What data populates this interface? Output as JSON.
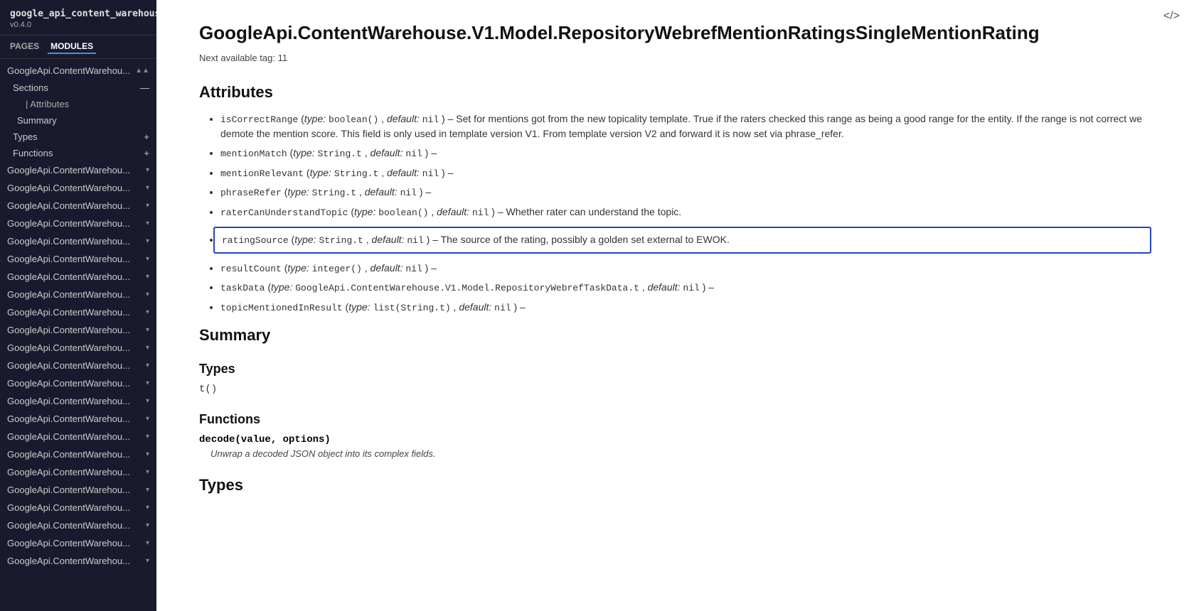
{
  "sidebar": {
    "app_title": "google_api_content_warehouse",
    "version": "v0.4.0",
    "tabs": [
      {
        "label": "PAGES",
        "active": false
      },
      {
        "label": "MODULES",
        "active": true
      }
    ],
    "nav": {
      "active_module": "GoogleApi.ContentWarehou...",
      "active_module_arrow": "▲",
      "sections_label": "Sections",
      "sections_collapse": "—",
      "attributes_indent": "| Attributes",
      "summary_label": "Summary",
      "types_label": "Types",
      "types_plus": "+",
      "functions_label": "Functions",
      "functions_plus": "+",
      "other_modules": [
        "GoogleApi.ContentWarehou...",
        "GoogleApi.ContentWarehou...",
        "GoogleApi.ContentWarehou...",
        "GoogleApi.ContentWarehou...",
        "GoogleApi.ContentWarehou...",
        "GoogleApi.ContentWarehou...",
        "GoogleApi.ContentWarehou...",
        "GoogleApi.ContentWarehou...",
        "GoogleApi.ContentWarehou...",
        "GoogleApi.ContentWarehou...",
        "GoogleApi.ContentWarehou...",
        "GoogleApi.ContentWarehou...",
        "GoogleApi.ContentWarehou...",
        "GoogleApi.ContentWarehou...",
        "GoogleApi.ContentWarehou...",
        "GoogleApi.ContentWarehou...",
        "GoogleApi.ContentWarehou...",
        "GoogleApi.ContentWarehou...",
        "GoogleApi.ContentWarehou...",
        "GoogleApi.ContentWarehou...",
        "GoogleApi.ContentWarehou...",
        "GoogleApi.ContentWarehou...",
        "GoogleApi.ContentWarehou..."
      ]
    }
  },
  "top_right_icon": "</>",
  "main": {
    "page_title": "GoogleApi.ContentWarehouse.V1.Model.RepositoryWebrefMentionRatingsSingleMentionRating",
    "next_tag_label": "Next available tag:",
    "next_tag_value": "11",
    "attributes_heading": "Attributes",
    "attributes": [
      {
        "name": "isCorrectRange",
        "type": "type: boolean()",
        "default": "default: nil",
        "desc": "– Set for mentions got from the new topicality template. True if the raters checked this range as being a good range for the entity. If the range is not correct we demote the mention score. This field is only used in template version V1. From template version V2 and forward it is now set via phrase_refer.",
        "highlighted": false
      },
      {
        "name": "mentionMatch",
        "type": "type: String.t",
        "default": "default: nil",
        "desc": "–",
        "highlighted": false
      },
      {
        "name": "mentionRelevant",
        "type": "type: String.t",
        "default": "default: nil",
        "desc": "–",
        "highlighted": false
      },
      {
        "name": "phraseRefer",
        "type": "type: String.t",
        "default": "default: nil",
        "desc": "–",
        "highlighted": false
      },
      {
        "name": "raterCanUnderstandTopic",
        "type": "type: boolean()",
        "default": "default: nil",
        "desc": "– Whether rater can understand the topic.",
        "highlighted": false
      },
      {
        "name": "ratingSource",
        "type": "type: String.t",
        "default": "default: nil",
        "desc": "– The source of the rating, possibly a golden set external to EWOK.",
        "highlighted": true
      },
      {
        "name": "resultCount",
        "type": "type: integer()",
        "default": "default: nil",
        "desc": "–",
        "highlighted": false
      },
      {
        "name": "taskData",
        "type": "type: GoogleApi.ContentWarehouse.V1.Model.RepositoryWebrefTaskData.t",
        "default": "default: nil",
        "desc": "–",
        "highlighted": false
      },
      {
        "name": "topicMentionedInResult",
        "type": "type: list(String.t)",
        "default": "default: nil",
        "desc": "–",
        "highlighted": false
      }
    ],
    "summary_heading": "Summary",
    "types_heading": "Types",
    "type_sig": "t()",
    "functions_heading": "Functions",
    "function_sig": "decode(value, options)",
    "function_desc": "Unwrap a decoded JSON object into its complex fields.",
    "types_heading2": "Types"
  }
}
